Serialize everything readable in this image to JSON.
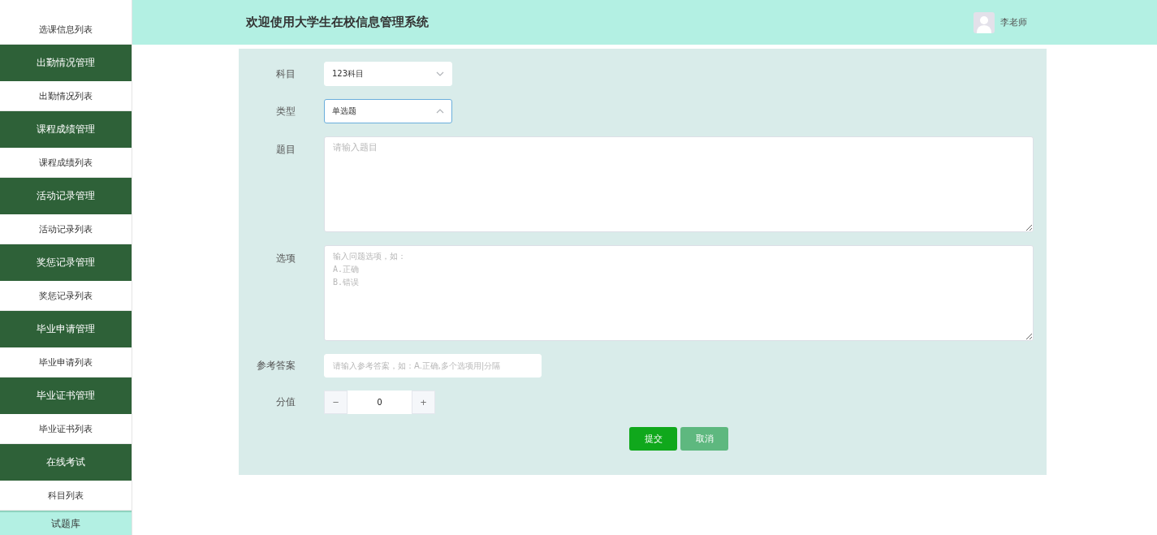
{
  "sidebar": {
    "items": [
      {
        "kind": "item",
        "label": "选课信息列表",
        "selected": false
      },
      {
        "kind": "group",
        "label": "出勤情况管理",
        "selected": false
      },
      {
        "kind": "item",
        "label": "出勤情况列表",
        "selected": false
      },
      {
        "kind": "group",
        "label": "课程成绩管理",
        "selected": false
      },
      {
        "kind": "item",
        "label": "课程成绩列表",
        "selected": false
      },
      {
        "kind": "group",
        "label": "活动记录管理",
        "selected": false
      },
      {
        "kind": "item",
        "label": "活动记录列表",
        "selected": false
      },
      {
        "kind": "group",
        "label": "奖惩记录管理",
        "selected": false
      },
      {
        "kind": "item",
        "label": "奖惩记录列表",
        "selected": false
      },
      {
        "kind": "group",
        "label": "毕业申请管理",
        "selected": false
      },
      {
        "kind": "item",
        "label": "毕业申请列表",
        "selected": false
      },
      {
        "kind": "group",
        "label": "毕业证书管理",
        "selected": false
      },
      {
        "kind": "item",
        "label": "毕业证书列表",
        "selected": false
      },
      {
        "kind": "group",
        "label": "在线考试",
        "selected": false
      },
      {
        "kind": "item",
        "label": "科目列表",
        "selected": false
      },
      {
        "kind": "item",
        "label": "试题库",
        "selected": true
      }
    ]
  },
  "header": {
    "title": "欢迎使用大学生在校信息管理系统",
    "user": "李老师"
  },
  "form": {
    "subject": {
      "label": "科目",
      "value": "123科目"
    },
    "type": {
      "label": "类型",
      "value": "单选题"
    },
    "question": {
      "label": "题目",
      "placeholder": "请输入题目"
    },
    "options": {
      "label": "选项",
      "placeholder": "输入问题选项，如：\nA.正确\nB.错误"
    },
    "answer": {
      "label": "参考答案",
      "placeholder": "请输入参考答案，如：A.正确,多个选项用|分隔"
    },
    "score": {
      "label": "分值",
      "minus": "−",
      "value": "0",
      "plus": "+"
    },
    "buttons": [
      {
        "kind": "primary",
        "label": "提交"
      },
      {
        "kind": "secondary",
        "label": "取消"
      }
    ]
  }
}
